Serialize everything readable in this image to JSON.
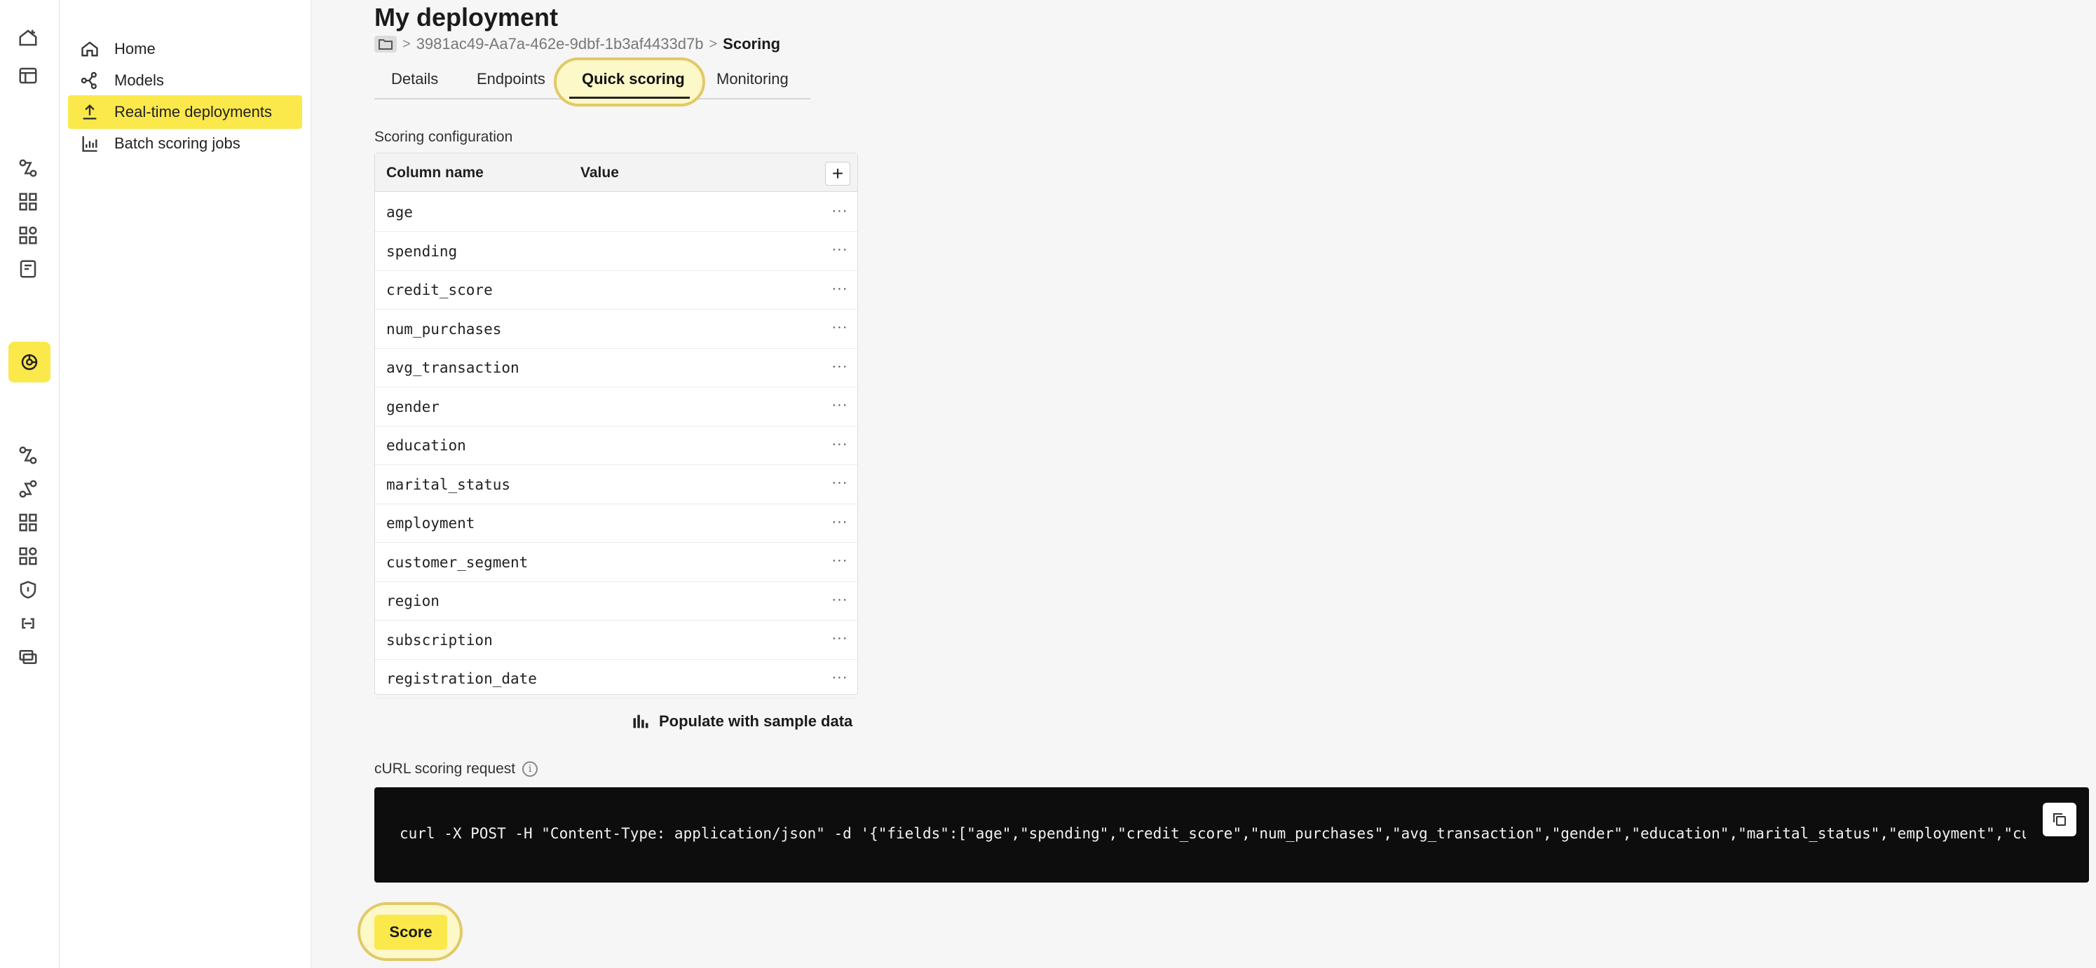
{
  "sidebar": {
    "items": [
      {
        "label": "Home",
        "icon": "home-icon"
      },
      {
        "label": "Models",
        "icon": "models-icon"
      },
      {
        "label": "Real-time deployments",
        "icon": "upload-icon"
      },
      {
        "label": "Batch scoring jobs",
        "icon": "batch-chart-icon"
      }
    ],
    "active_index": 2
  },
  "header": {
    "title": "My deployment",
    "breadcrumb": {
      "deployment_id": "3981ac49-Aa7a-462e-9dbf-1b3af4433d7b",
      "separator": ">",
      "current": "Scoring"
    }
  },
  "tabs": [
    {
      "label": "Details"
    },
    {
      "label": "Endpoints"
    },
    {
      "label": "Quick scoring"
    },
    {
      "label": "Monitoring"
    }
  ],
  "active_tab": "Quick scoring",
  "scoring": {
    "section_label": "Scoring configuration",
    "columns": {
      "name": "Column name",
      "value": "Value"
    },
    "add_label": "+",
    "menu_label": "···",
    "rows": [
      {
        "name": "age",
        "value": ""
      },
      {
        "name": "spending",
        "value": ""
      },
      {
        "name": "credit_score",
        "value": ""
      },
      {
        "name": "num_purchases",
        "value": ""
      },
      {
        "name": "avg_transaction",
        "value": ""
      },
      {
        "name": "gender",
        "value": ""
      },
      {
        "name": "education",
        "value": ""
      },
      {
        "name": "marital_status",
        "value": ""
      },
      {
        "name": "employment",
        "value": ""
      },
      {
        "name": "customer_segment",
        "value": ""
      },
      {
        "name": "region",
        "value": ""
      },
      {
        "name": "subscription",
        "value": ""
      },
      {
        "name": "registration_date",
        "value": ""
      }
    ],
    "populate_label": "Populate with sample data"
  },
  "curl": {
    "label": "cURL scoring request",
    "info_glyph": "i",
    "command": "curl -X POST -H \"Content-Type: application/json\" -d '{\"fields\":[\"age\",\"spending\",\"credit_score\",\"num_purchases\",\"avg_transaction\",\"gender\",\"education\",\"marital_status\",\"employment\",\"cus"
  },
  "score_button": {
    "label": "Score"
  },
  "colors": {
    "accent": "#fbe84b",
    "highlight_ring": "#e2c967",
    "code_bg": "#0d0d0d"
  }
}
